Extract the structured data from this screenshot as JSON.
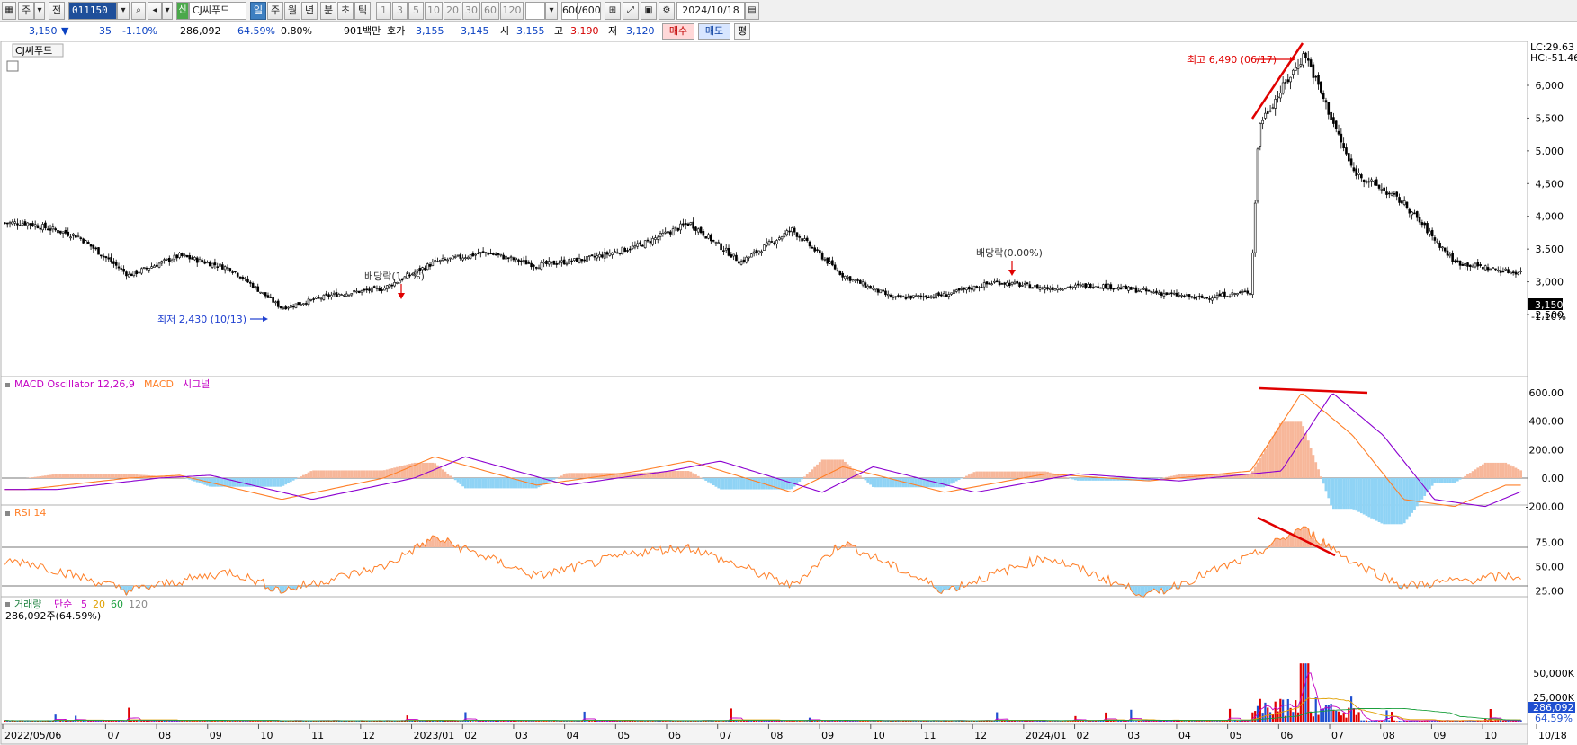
{
  "toolbar": {
    "market": "주",
    "prev": "전",
    "code": "011150",
    "badge": "신",
    "stock_name": "CJ씨푸드",
    "periods": [
      "일",
      "주",
      "월",
      "년",
      "분",
      "초",
      "틱"
    ],
    "active_period": "일",
    "minute_units": [
      "1",
      "3",
      "5",
      "10",
      "20",
      "30",
      "60",
      "120"
    ],
    "count": "600",
    "count_total": "/600",
    "date": "2024/10/18"
  },
  "quote": {
    "price": "3,150",
    "change_arrow": "▼",
    "change": "35",
    "change_pct": "-1.10%",
    "volume": "286,092",
    "volume_ratio": "64.59%",
    "turnover": "0.80%",
    "amount": "901백만",
    "ask_label": "호가",
    "ask": "3,155",
    "bid": "3,145",
    "open_label": "시",
    "open": "3,155",
    "high_label": "고",
    "high": "3,190",
    "low_label": "저",
    "low": "3,120",
    "buy_label": "매수",
    "sell_label": "매도",
    "eval_label": "평"
  },
  "price_panel": {
    "title": "CJ씨푸드",
    "lc": "LC:29.63",
    "hc": "HC:-51.46",
    "y_ticks": [
      "6,000",
      "5,500",
      "5,000",
      "4,500",
      "4,000",
      "3,500",
      "3,000",
      "2,500"
    ],
    "current_price_tag": "3,150",
    "current_pct": "-1.10%",
    "annotation_high": "최고 6,490 (06/17)",
    "annotation_low": "최저 2,430 (10/13)",
    "dividend_1": "배당락(1.1%)",
    "dividend_2": "배당락(0.00%)"
  },
  "macd_panel": {
    "osc_label": "MACD Oscillator 12,26,9",
    "macd_label": "MACD",
    "signal_label": "시그널",
    "y_ticks": [
      "600.00",
      "400.00",
      "200.00",
      "0.00",
      "-200.00"
    ]
  },
  "rsi_panel": {
    "label": "RSI 14",
    "y_ticks": [
      "75.00",
      "50.00",
      "25.00"
    ]
  },
  "volume_panel": {
    "label": "거래량",
    "ma_label": "단순",
    "ma_periods": [
      "5",
      "20",
      "60",
      "120"
    ],
    "summary": "286,092주(64.59%)",
    "y_ticks": [
      "50,000K",
      "25,000K"
    ],
    "current_tag": "286,092",
    "current_pct": "64.59%"
  },
  "x_axis": {
    "labels": [
      "2022/05/06",
      "07",
      "08",
      "09",
      "10",
      "11",
      "12",
      "2023/01",
      "02",
      "03",
      "04",
      "05",
      "06",
      "07",
      "08",
      "09",
      "10",
      "11",
      "12",
      "2024/01",
      "02",
      "03",
      "04",
      "05",
      "06",
      "07",
      "08",
      "09",
      "10",
      "10/18"
    ]
  },
  "colors": {
    "candle": "#000000",
    "macd": "#ff7f27",
    "signal": "#8b00d0",
    "osc_pos": "#f7b79a",
    "osc_neg": "#8fd3f5",
    "rsi": "#ff7f27",
    "trend_red": "#e00000",
    "volume_up": "#e00000",
    "volume_down": "#1f4fd0"
  },
  "chart_data": {
    "type": "line",
    "instrument": "CJ씨푸드",
    "x_range": [
      "2022/05/06",
      "2024/10/18"
    ],
    "ylim": [
      2430,
      6490
    ],
    "series": [
      {
        "name": "price_close",
        "x": [
          "2022/05",
          "2022/06",
          "2022/07",
          "2022/08",
          "2022/09",
          "2022/10",
          "2022/11",
          "2022/12",
          "2023/01",
          "2023/02",
          "2023/03",
          "2023/04",
          "2023/05",
          "2023/06",
          "2023/07",
          "2023/08",
          "2023/09",
          "2023/10",
          "2023/11",
          "2023/12",
          "2024/01",
          "2024/02",
          "2024/03",
          "2024/04",
          "2024/05",
          "2024/05/20",
          "2024/06/17",
          "2024/07",
          "2024/08",
          "2024/09",
          "2024/10/18"
        ],
        "values": [
          3900,
          3700,
          3100,
          3400,
          3200,
          2600,
          2800,
          2900,
          3300,
          3450,
          3250,
          3350,
          3550,
          3900,
          3300,
          3800,
          3100,
          2750,
          2800,
          3000,
          2900,
          2950,
          2850,
          2750,
          2850,
          5400,
          6490,
          4700,
          4200,
          3300,
          3150
        ]
      },
      {
        "name": "MACD",
        "x": [
          "2022/05",
          "2022/07",
          "2022/08",
          "2022/10",
          "2022/12",
          "2023/01",
          "2023/03",
          "2023/05",
          "2023/06",
          "2023/08",
          "2023/09",
          "2023/11",
          "2024/01",
          "2024/03",
          "2024/05",
          "2024/06",
          "2024/07",
          "2024/08",
          "2024/09",
          "2024/10"
        ],
        "values": [
          -80,
          0,
          20,
          -150,
          0,
          150,
          -50,
          50,
          120,
          -100,
          80,
          -100,
          30,
          -20,
          50,
          600,
          300,
          -150,
          -200,
          -50
        ]
      },
      {
        "name": "RSI 14",
        "x": [
          "2022/05",
          "2022/07",
          "2022/09",
          "2022/10",
          "2022/12",
          "2023/01",
          "2023/03",
          "2023/05",
          "2023/06",
          "2023/08",
          "2023/09",
          "2023/11",
          "2024/01",
          "2024/03",
          "2024/05",
          "2024/06",
          "2024/07",
          "2024/08",
          "2024/10"
        ],
        "values": [
          55,
          25,
          45,
          25,
          50,
          80,
          40,
          65,
          70,
          30,
          75,
          25,
          60,
          20,
          60,
          90,
          55,
          30,
          40
        ]
      }
    ]
  }
}
